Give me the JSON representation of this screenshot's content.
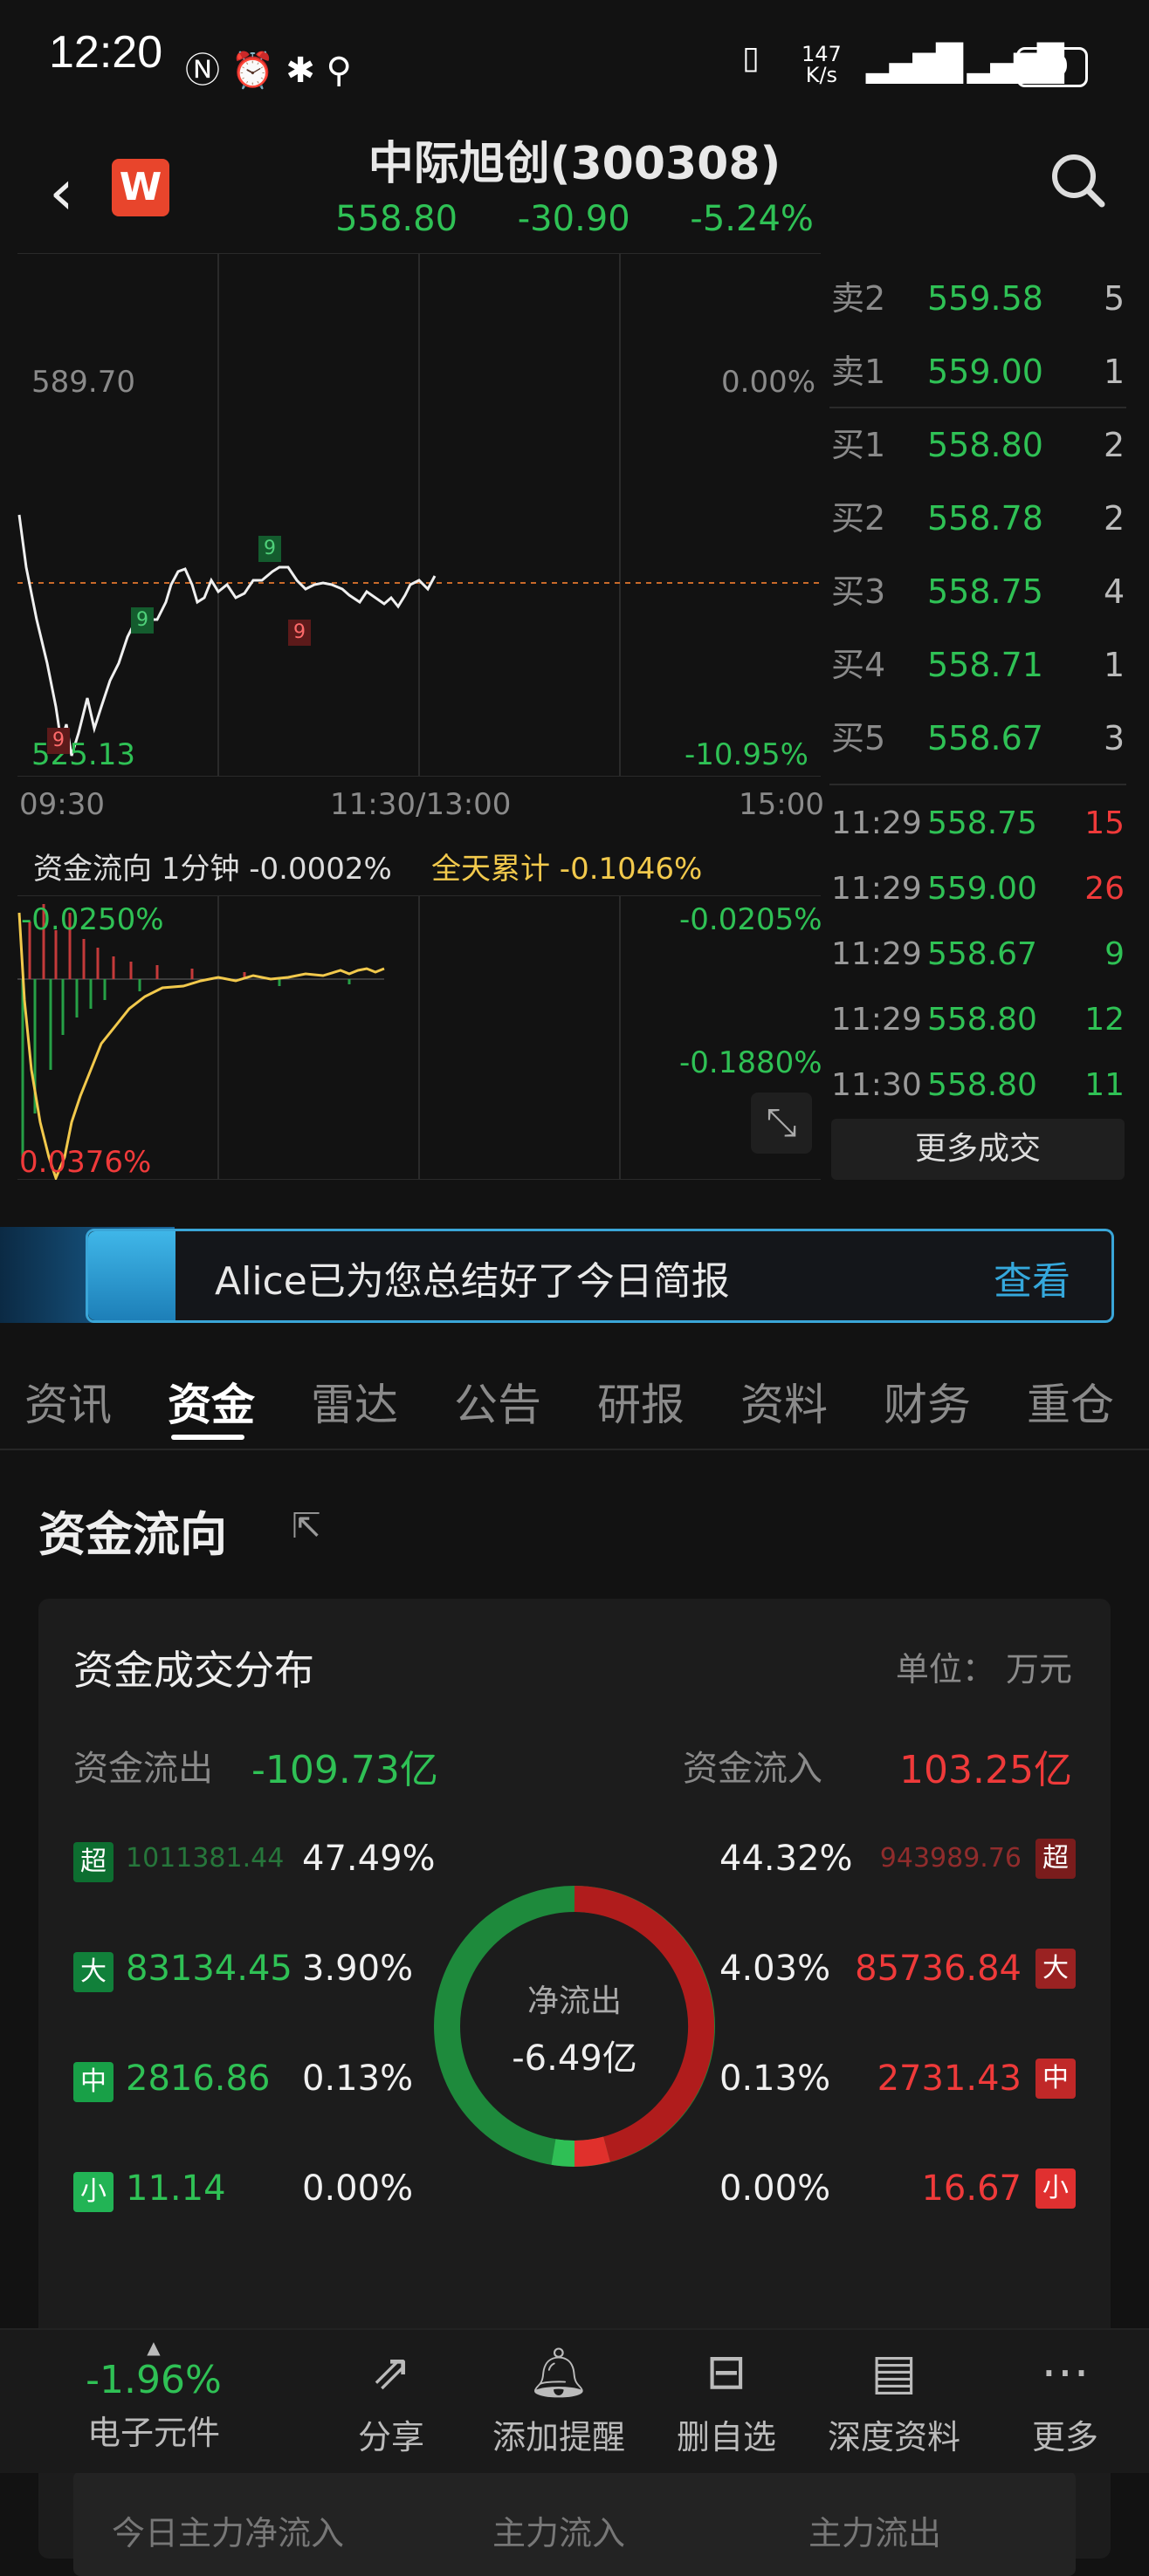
{
  "status_bar": {
    "time": "12:20",
    "net_speed": "147\nK/s",
    "battery": "49"
  },
  "header": {
    "title": "中际旭创(300308)",
    "price": "558.80",
    "change": "-30.90",
    "change_pct": "-5.24%"
  },
  "chart": {
    "y_top_left": "589.70",
    "y_top_right": "0.00%",
    "y_bottom_left": "525.13",
    "y_bottom_right": "-10.95%",
    "x_labels": [
      "09:30",
      "11:30/13:00",
      "15:00"
    ],
    "markers": [
      "9",
      "9",
      "9",
      "9"
    ]
  },
  "fund_flow_strip": {
    "label": "资金流向 1分钟 -0.0002%",
    "cumulative": "全天累计 -0.1046%",
    "tl": "-0.0250%",
    "tr": "-0.0205%",
    "mr": "-0.1880%",
    "bl": "0.0376%"
  },
  "order_book": [
    {
      "label": "卖2",
      "price": "559.58",
      "vol": "5"
    },
    {
      "label": "卖1",
      "price": "559.00",
      "vol": "1"
    },
    {
      "label": "买1",
      "price": "558.80",
      "vol": "2"
    },
    {
      "label": "买2",
      "price": "558.78",
      "vol": "2"
    },
    {
      "label": "买3",
      "price": "558.75",
      "vol": "4"
    },
    {
      "label": "买4",
      "price": "558.71",
      "vol": "1"
    },
    {
      "label": "买5",
      "price": "558.67",
      "vol": "3"
    }
  ],
  "trades": [
    {
      "time": "11:29",
      "price": "558.75",
      "vol": "15",
      "dir": "red"
    },
    {
      "time": "11:29",
      "price": "559.00",
      "vol": "26",
      "dir": "red"
    },
    {
      "time": "11:29",
      "price": "558.67",
      "vol": "9",
      "dir": "green"
    },
    {
      "time": "11:29",
      "price": "558.80",
      "vol": "12",
      "dir": "green"
    },
    {
      "time": "11:30",
      "price": "558.80",
      "vol": "11",
      "dir": "green"
    }
  ],
  "more_trades_label": "更多成交",
  "banner": {
    "text": "Alice已为您总结好了今日简报",
    "action": "查看"
  },
  "tabs": [
    "资讯",
    "资金",
    "雷达",
    "公告",
    "研报",
    "资料",
    "财务",
    "重仓"
  ],
  "section_title": "资金流向",
  "card": {
    "title": "资金成交分布",
    "unit": "单位： 万元",
    "outflow_label": "资金流出",
    "outflow_value": "-109.73亿",
    "inflow_label": "资金流入",
    "inflow_value": "103.25亿",
    "center_label": "净流出",
    "center_value": "-6.49亿",
    "rows": [
      {
        "badge": "超",
        "out_amt": "1011381.44",
        "out_pct": "47.49%",
        "in_pct": "44.32%",
        "in_amt": "943989.76"
      },
      {
        "badge": "大",
        "out_amt": "83134.45",
        "out_pct": "3.90%",
        "in_pct": "4.03%",
        "in_amt": "85736.84"
      },
      {
        "badge": "中",
        "out_amt": "2816.86",
        "out_pct": "0.13%",
        "in_pct": "0.13%",
        "in_amt": "2731.43"
      },
      {
        "badge": "小",
        "out_amt": "11.14",
        "out_pct": "0.00%",
        "in_pct": "0.00%",
        "in_amt": "16.67"
      }
    ],
    "footer_labels": [
      "今日主力净流入",
      "主力流入",
      "主力流出"
    ],
    "donut": {
      "outflow_share": 0.515,
      "inflow_share": 0.485
    }
  },
  "bottom_nav": [
    {
      "label": "电子元件",
      "value": "-1.96%",
      "icon": "sector-indicator"
    },
    {
      "label": "分享",
      "icon": "share-icon"
    },
    {
      "label": "添加提醒",
      "icon": "bell-icon"
    },
    {
      "label": "删自选",
      "icon": "remove-watchlist-icon"
    },
    {
      "label": "深度资料",
      "icon": "report-icon"
    },
    {
      "label": "更多",
      "icon": "more-icon"
    }
  ]
}
